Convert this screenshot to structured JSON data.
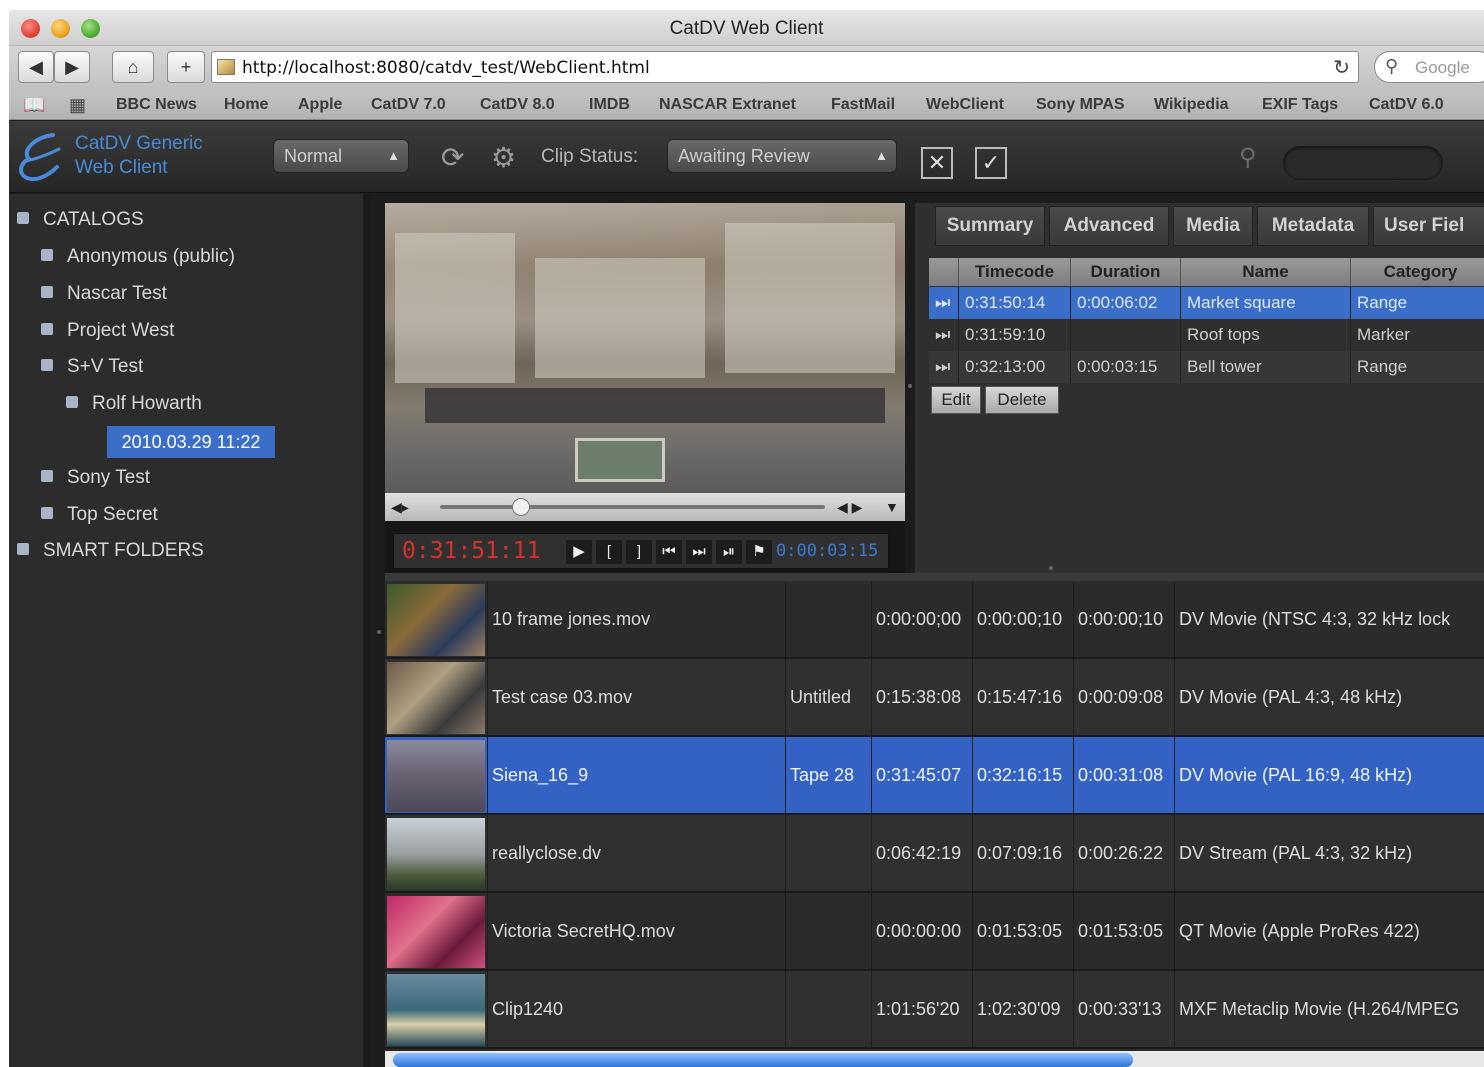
{
  "window": {
    "title": "CatDV Web Client"
  },
  "browser": {
    "url": "http://localhost:8080/catdv_test/WebClient.html",
    "search_placeholder": "Google",
    "bookmarks": [
      "BBC News",
      "Home",
      "Apple",
      "CatDV 7.0",
      "CatDV 8.0",
      "IMDB",
      "NASCAR Extranet",
      "FastMail",
      "WebClient",
      "Sony MPAS",
      "Wikipedia",
      "EXIF Tags",
      "CatDV 6.0"
    ]
  },
  "app": {
    "logo_line1": "CatDV Generic",
    "logo_line2": "Web Client",
    "view_mode": "Normal",
    "clip_status_label": "Clip Status:",
    "clip_status_value": "Awaiting Review"
  },
  "tree": {
    "catalogs_label": "CATALOGS",
    "items": [
      "Anonymous (public)",
      "Nascar Test",
      "Project West",
      "S+V Test",
      "Rolf Howarth",
      "Sony Test",
      "Top Secret"
    ],
    "selected": "2010.03.29 11:22",
    "smart_folders_label": "SMART FOLDERS"
  },
  "player": {
    "current_timecode": "0:31:51:11",
    "duration": "0:00:03:15",
    "scrub_position": 0.21
  },
  "details": {
    "tabs": [
      "Summary",
      "Advanced",
      "Media",
      "Metadata",
      "User Fiel"
    ],
    "columns": [
      "Timecode",
      "Duration",
      "Name",
      "Category"
    ],
    "markers": [
      {
        "timecode": "0:31:50:14",
        "duration": "0:00:06:02",
        "name": "Market square",
        "category": "Range"
      },
      {
        "timecode": "0:31:59:10",
        "duration": "",
        "name": "Roof tops",
        "category": "Marker"
      },
      {
        "timecode": "0:32:13:00",
        "duration": "0:00:03:15",
        "name": "Bell tower",
        "category": "Range"
      }
    ],
    "edit_label": "Edit",
    "delete_label": "Delete"
  },
  "clips": [
    {
      "name": "10 frame jones.mov",
      "tape": "",
      "in": "0:00:00;00",
      "out": "0:00:00;10",
      "duration": "0:00:00;10",
      "format": "DV Movie (NTSC 4:3, 32 kHz lock"
    },
    {
      "name": "Test case 03.mov",
      "tape": "Untitled",
      "in": "0:15:38:08",
      "out": "0:15:47:16",
      "duration": "0:00:09:08",
      "format": "DV Movie (PAL 4:3, 48 kHz)"
    },
    {
      "name": "Siena_16_9",
      "tape": "Tape 28",
      "in": "0:31:45:07",
      "out": "0:32:16:15",
      "duration": "0:00:31:08",
      "format": "DV Movie (PAL 16:9, 48 kHz)"
    },
    {
      "name": "reallyclose.dv",
      "tape": "",
      "in": "0:06:42:19",
      "out": "0:07:09:16",
      "duration": "0:00:26:22",
      "format": "DV Stream (PAL 4:3, 32 kHz)"
    },
    {
      "name": "Victoria SecretHQ.mov",
      "tape": "",
      "in": "0:00:00:00",
      "out": "0:01:53:05",
      "duration": "0:01:53:05",
      "format": "QT Movie (Apple ProRes 422)"
    },
    {
      "name": "Clip1240",
      "tape": "",
      "in": "1:01:56'20",
      "out": "1:02:30'09",
      "duration": "0:00:33'13",
      "format": "MXF Metaclip Movie (H.264/MPEG"
    }
  ]
}
